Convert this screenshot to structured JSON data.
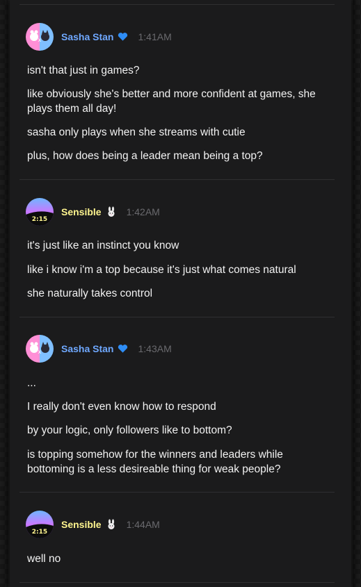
{
  "messages": [
    {
      "username": "Sasha Stan",
      "badge_icon": "blue-heart-icon",
      "timestamp": "1:41AM",
      "lines": [
        "isn't that just in games?",
        "like obviously she's better and more confident at games, she plays them all day!",
        "sasha only plays when she streams with cutie",
        "plus, how does being a leader mean being a top?"
      ]
    },
    {
      "username": "Sensible",
      "badge_icon": "bunny-icon",
      "timestamp": "1:42AM",
      "lines": [
        "it's just like an instinct you know",
        "like i know i'm a top because it's just what comes natural",
        "she naturally takes control"
      ]
    },
    {
      "username": "Sasha Stan",
      "badge_icon": "blue-heart-icon",
      "timestamp": "1:43AM",
      "lines": [
        "...",
        "I really don't even know how to respond",
        "by your logic, only followers like to bottom?",
        "is topping somehow for the winners and leaders while bottoming is a less desireable thing for weak people?"
      ]
    },
    {
      "username": "Sensible",
      "badge_icon": "bunny-icon",
      "timestamp": "1:44AM",
      "lines": [
        "well no"
      ]
    }
  ],
  "colors": {
    "sasha_name": "#6fa8ff",
    "sensible_name": "#fff58f",
    "timestamp": "#6a6a6e",
    "text": "#f2f2f2",
    "panel": "#1b1b1c"
  }
}
